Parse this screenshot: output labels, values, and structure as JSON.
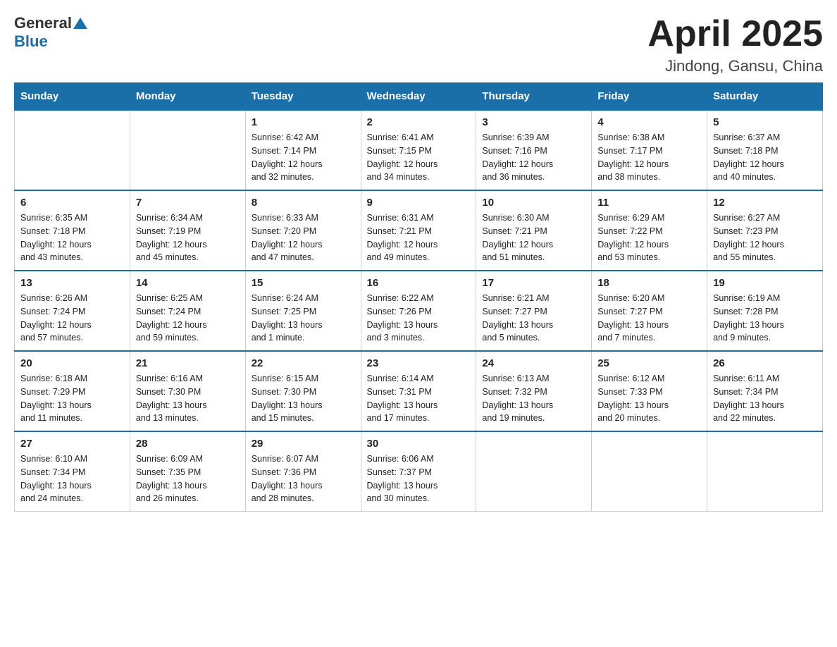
{
  "header": {
    "logo_general": "General",
    "logo_blue": "Blue",
    "month_year": "April 2025",
    "location": "Jindong, Gansu, China"
  },
  "days_of_week": [
    "Sunday",
    "Monday",
    "Tuesday",
    "Wednesday",
    "Thursday",
    "Friday",
    "Saturday"
  ],
  "weeks": [
    [
      {
        "day": "",
        "info": ""
      },
      {
        "day": "",
        "info": ""
      },
      {
        "day": "1",
        "info": "Sunrise: 6:42 AM\nSunset: 7:14 PM\nDaylight: 12 hours\nand 32 minutes."
      },
      {
        "day": "2",
        "info": "Sunrise: 6:41 AM\nSunset: 7:15 PM\nDaylight: 12 hours\nand 34 minutes."
      },
      {
        "day": "3",
        "info": "Sunrise: 6:39 AM\nSunset: 7:16 PM\nDaylight: 12 hours\nand 36 minutes."
      },
      {
        "day": "4",
        "info": "Sunrise: 6:38 AM\nSunset: 7:17 PM\nDaylight: 12 hours\nand 38 minutes."
      },
      {
        "day": "5",
        "info": "Sunrise: 6:37 AM\nSunset: 7:18 PM\nDaylight: 12 hours\nand 40 minutes."
      }
    ],
    [
      {
        "day": "6",
        "info": "Sunrise: 6:35 AM\nSunset: 7:18 PM\nDaylight: 12 hours\nand 43 minutes."
      },
      {
        "day": "7",
        "info": "Sunrise: 6:34 AM\nSunset: 7:19 PM\nDaylight: 12 hours\nand 45 minutes."
      },
      {
        "day": "8",
        "info": "Sunrise: 6:33 AM\nSunset: 7:20 PM\nDaylight: 12 hours\nand 47 minutes."
      },
      {
        "day": "9",
        "info": "Sunrise: 6:31 AM\nSunset: 7:21 PM\nDaylight: 12 hours\nand 49 minutes."
      },
      {
        "day": "10",
        "info": "Sunrise: 6:30 AM\nSunset: 7:21 PM\nDaylight: 12 hours\nand 51 minutes."
      },
      {
        "day": "11",
        "info": "Sunrise: 6:29 AM\nSunset: 7:22 PM\nDaylight: 12 hours\nand 53 minutes."
      },
      {
        "day": "12",
        "info": "Sunrise: 6:27 AM\nSunset: 7:23 PM\nDaylight: 12 hours\nand 55 minutes."
      }
    ],
    [
      {
        "day": "13",
        "info": "Sunrise: 6:26 AM\nSunset: 7:24 PM\nDaylight: 12 hours\nand 57 minutes."
      },
      {
        "day": "14",
        "info": "Sunrise: 6:25 AM\nSunset: 7:24 PM\nDaylight: 12 hours\nand 59 minutes."
      },
      {
        "day": "15",
        "info": "Sunrise: 6:24 AM\nSunset: 7:25 PM\nDaylight: 13 hours\nand 1 minute."
      },
      {
        "day": "16",
        "info": "Sunrise: 6:22 AM\nSunset: 7:26 PM\nDaylight: 13 hours\nand 3 minutes."
      },
      {
        "day": "17",
        "info": "Sunrise: 6:21 AM\nSunset: 7:27 PM\nDaylight: 13 hours\nand 5 minutes."
      },
      {
        "day": "18",
        "info": "Sunrise: 6:20 AM\nSunset: 7:27 PM\nDaylight: 13 hours\nand 7 minutes."
      },
      {
        "day": "19",
        "info": "Sunrise: 6:19 AM\nSunset: 7:28 PM\nDaylight: 13 hours\nand 9 minutes."
      }
    ],
    [
      {
        "day": "20",
        "info": "Sunrise: 6:18 AM\nSunset: 7:29 PM\nDaylight: 13 hours\nand 11 minutes."
      },
      {
        "day": "21",
        "info": "Sunrise: 6:16 AM\nSunset: 7:30 PM\nDaylight: 13 hours\nand 13 minutes."
      },
      {
        "day": "22",
        "info": "Sunrise: 6:15 AM\nSunset: 7:30 PM\nDaylight: 13 hours\nand 15 minutes."
      },
      {
        "day": "23",
        "info": "Sunrise: 6:14 AM\nSunset: 7:31 PM\nDaylight: 13 hours\nand 17 minutes."
      },
      {
        "day": "24",
        "info": "Sunrise: 6:13 AM\nSunset: 7:32 PM\nDaylight: 13 hours\nand 19 minutes."
      },
      {
        "day": "25",
        "info": "Sunrise: 6:12 AM\nSunset: 7:33 PM\nDaylight: 13 hours\nand 20 minutes."
      },
      {
        "day": "26",
        "info": "Sunrise: 6:11 AM\nSunset: 7:34 PM\nDaylight: 13 hours\nand 22 minutes."
      }
    ],
    [
      {
        "day": "27",
        "info": "Sunrise: 6:10 AM\nSunset: 7:34 PM\nDaylight: 13 hours\nand 24 minutes."
      },
      {
        "day": "28",
        "info": "Sunrise: 6:09 AM\nSunset: 7:35 PM\nDaylight: 13 hours\nand 26 minutes."
      },
      {
        "day": "29",
        "info": "Sunrise: 6:07 AM\nSunset: 7:36 PM\nDaylight: 13 hours\nand 28 minutes."
      },
      {
        "day": "30",
        "info": "Sunrise: 6:06 AM\nSunset: 7:37 PM\nDaylight: 13 hours\nand 30 minutes."
      },
      {
        "day": "",
        "info": ""
      },
      {
        "day": "",
        "info": ""
      },
      {
        "day": "",
        "info": ""
      }
    ]
  ]
}
